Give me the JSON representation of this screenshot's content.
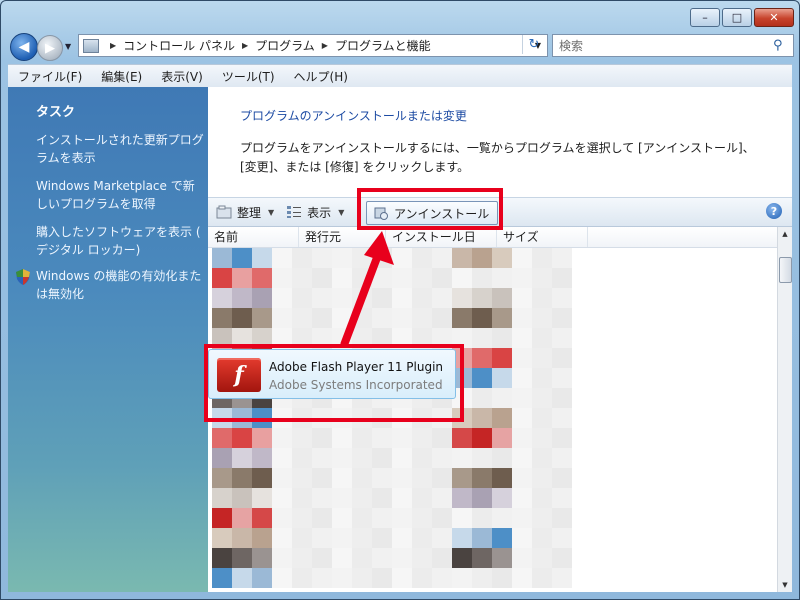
{
  "window": {
    "minimize": "–",
    "maximize": "□",
    "close": "✕"
  },
  "address": {
    "crumbs": [
      "コントロール パネル",
      "プログラム",
      "プログラムと機能"
    ],
    "search_placeholder": "検索"
  },
  "menu": [
    "ファイル(F)",
    "編集(E)",
    "表示(V)",
    "ツール(T)",
    "ヘルプ(H)"
  ],
  "sidebar": {
    "heading": "タスク",
    "items": [
      "インストールされた更新プログラムを表示",
      "Windows Marketplace で新しいプログラムを取得",
      "購入したソフトウェアを表示 ( デジタル ロッカー)",
      "Windows の機能の有効化または無効化"
    ]
  },
  "main": {
    "title": "プログラムのアンインストールまたは変更",
    "description": "プログラムをアンインストールするには、一覧からプログラムを選択して [アンインストール]、[変更]、または [修復] をクリックします。"
  },
  "toolbar": {
    "organize": "整理",
    "view": "表示",
    "uninstall": "アンインストール",
    "help": "?"
  },
  "columns": [
    "名前",
    "発行元",
    "インストール日",
    "サイズ"
  ],
  "selected_program": {
    "name": "Adobe Flash Player 11 Plugin",
    "publisher": "Adobe Systems Incorporated",
    "icon_glyph": "f"
  },
  "colors": {
    "annotation": "#e8001c",
    "link": "#1d4ba3"
  }
}
